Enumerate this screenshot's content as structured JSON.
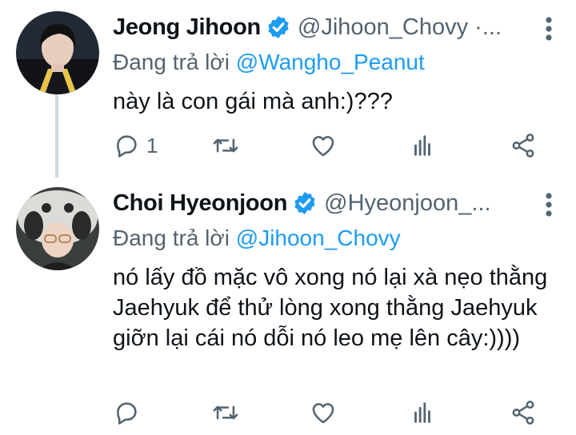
{
  "tweets": [
    {
      "name": "Jeong Jihoon",
      "handle": "@Jihoon_Chovy ·...",
      "replying_prefix": "Đang trả lời ",
      "replying_to": "@Wangho_Peanut",
      "text": "này là con gái mà anh:)???",
      "reply_count": "1",
      "icons": [
        "reply-icon",
        "retweet-icon",
        "like-icon",
        "analytics-icon",
        "share-icon"
      ]
    },
    {
      "name": "Choi Hyeonjoon",
      "handle": "@Hyeonjoon_...",
      "replying_prefix": "Đang trả lời ",
      "replying_to": "@Jihoon_Chovy",
      "text": "nó lấy đồ mặc vô xong nó lại xà nẹo thằng Jaehyuk để thử lòng xong thằng Jaehyuk giỡn lại cái nó dỗi nó leo mẹ lên cây:))))",
      "reply_count": "",
      "icons": [
        "reply-icon",
        "retweet-icon",
        "like-icon",
        "analytics-icon",
        "share-icon"
      ]
    }
  ],
  "colors": {
    "accent": "#1d9bf0",
    "muted": "#536471",
    "text": "#0f1419",
    "thread_line": "#cfd9de"
  }
}
